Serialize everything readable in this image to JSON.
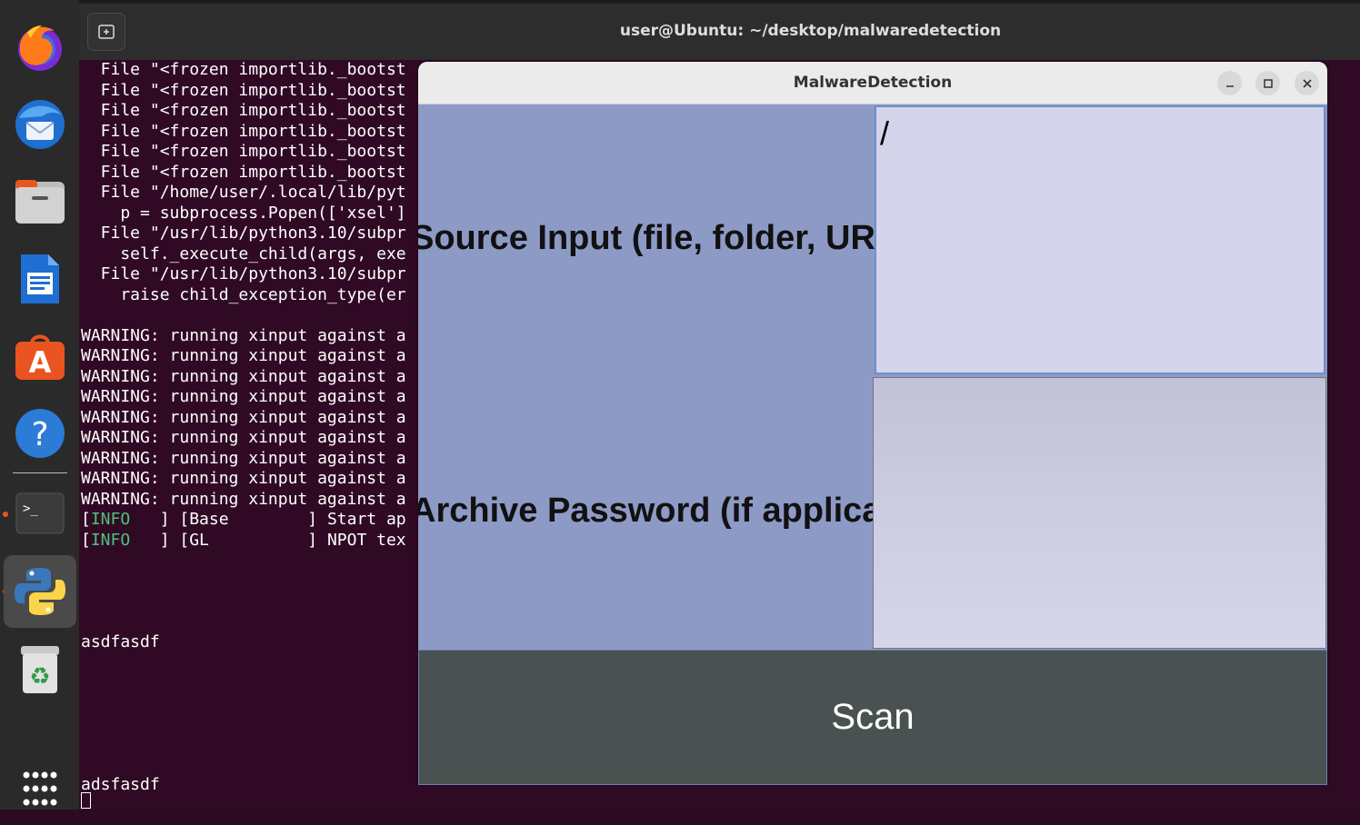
{
  "terminal": {
    "title": "user@Ubuntu: ~/desktop/malwaredetection",
    "lines": [
      "  File \"<frozen importlib._bootst",
      "  File \"<frozen importlib._bootst",
      "  File \"<frozen importlib._bootst",
      "  File \"<frozen importlib._bootst",
      "  File \"<frozen importlib._bootst",
      "  File \"<frozen importlib._bootst",
      "  File \"/home/user/.local/lib/pyt",
      "    p = subprocess.Popen(['xsel']",
      "  File \"/usr/lib/python3.10/subpr",
      "    self._execute_child(args, exe",
      "  File \"/usr/lib/python3.10/subpr",
      "    raise child_exception_type(er",
      "",
      "WARNING: running xinput against a",
      "WARNING: running xinput against a",
      "WARNING: running xinput against a",
      "WARNING: running xinput against a",
      "WARNING: running xinput against a",
      "WARNING: running xinput against a",
      "WARNING: running xinput against a",
      "WARNING: running xinput against a",
      "WARNING: running xinput against a"
    ],
    "info_lines": [
      {
        "open": "[",
        "tag": "INFO",
        "rest": "   ] [Base        ] Start ap"
      },
      {
        "open": "[",
        "tag": "INFO",
        "rest": "   ] [GL          ] NPOT tex"
      }
    ],
    "input1": "asdfasdf",
    "input2": "adsfasdf"
  },
  "app": {
    "title": "MalwareDetection",
    "source_label": "Source Input (file, folder, URL):",
    "source_value": "/",
    "password_label": "Archive Password (if applicab",
    "password_value": "",
    "scan_label": "Scan"
  },
  "dock": {
    "apps": [
      "firefox-icon",
      "thunderbird-icon",
      "files-icon",
      "writer-icon",
      "app-center-icon",
      "help-icon",
      "terminal-icon",
      "python-icon",
      "trash-icon",
      "app-grid-icon"
    ]
  },
  "colors": {
    "terminal_bg": "#300a24",
    "app_bg": "#8e9ac6",
    "scan_bg": "#4a5251",
    "accent": "#e95420",
    "info_green": "#4ec17a"
  }
}
